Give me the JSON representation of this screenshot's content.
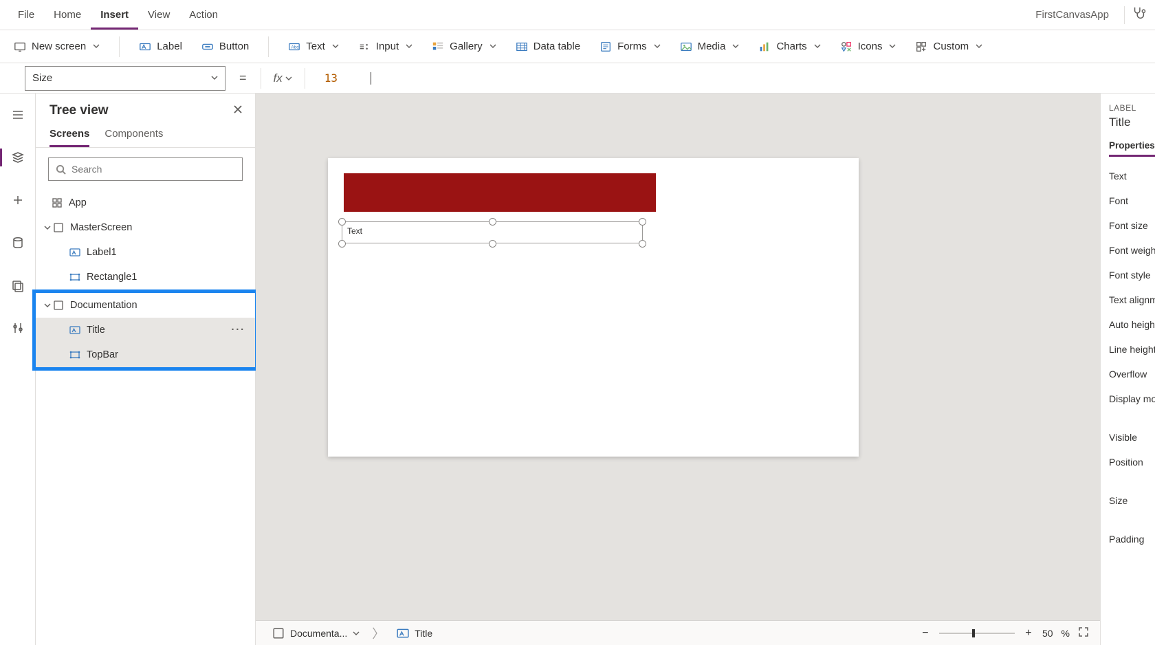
{
  "appName": "FirstCanvasApp",
  "menu": {
    "file": "File",
    "home": "Home",
    "insert": "Insert",
    "view": "View",
    "action": "Action"
  },
  "ribbon": {
    "newScreen": "New screen",
    "label": "Label",
    "button": "Button",
    "text": "Text",
    "input": "Input",
    "gallery": "Gallery",
    "dataTable": "Data table",
    "forms": "Forms",
    "media": "Media",
    "charts": "Charts",
    "icons": "Icons",
    "custom": "Custom"
  },
  "formula": {
    "property": "Size",
    "value": "13"
  },
  "treeview": {
    "title": "Tree view",
    "tabScreens": "Screens",
    "tabComponents": "Components",
    "searchPlaceholder": "Search",
    "app": "App",
    "masterScreen": "MasterScreen",
    "label1": "Label1",
    "rectangle1": "Rectangle1",
    "documentation": "Documentation",
    "title2": "Title",
    "topBar": "TopBar"
  },
  "canvas": {
    "selectedText": "Text",
    "breadcrumbScreen": "Documenta...",
    "breadcrumbControl": "Title",
    "zoomValue": "50",
    "zoomUnit": "%"
  },
  "props": {
    "kind": "LABEL",
    "name": "Title",
    "tab": "Properties",
    "rows": [
      "Text",
      "Font",
      "Font size",
      "Font weight",
      "Font style",
      "Text alignme",
      "Auto height",
      "Line height",
      "Overflow",
      "Display mod"
    ],
    "rows2": [
      "Visible",
      "Position"
    ],
    "rows3": [
      "Size"
    ],
    "rows4": [
      "Padding"
    ]
  }
}
